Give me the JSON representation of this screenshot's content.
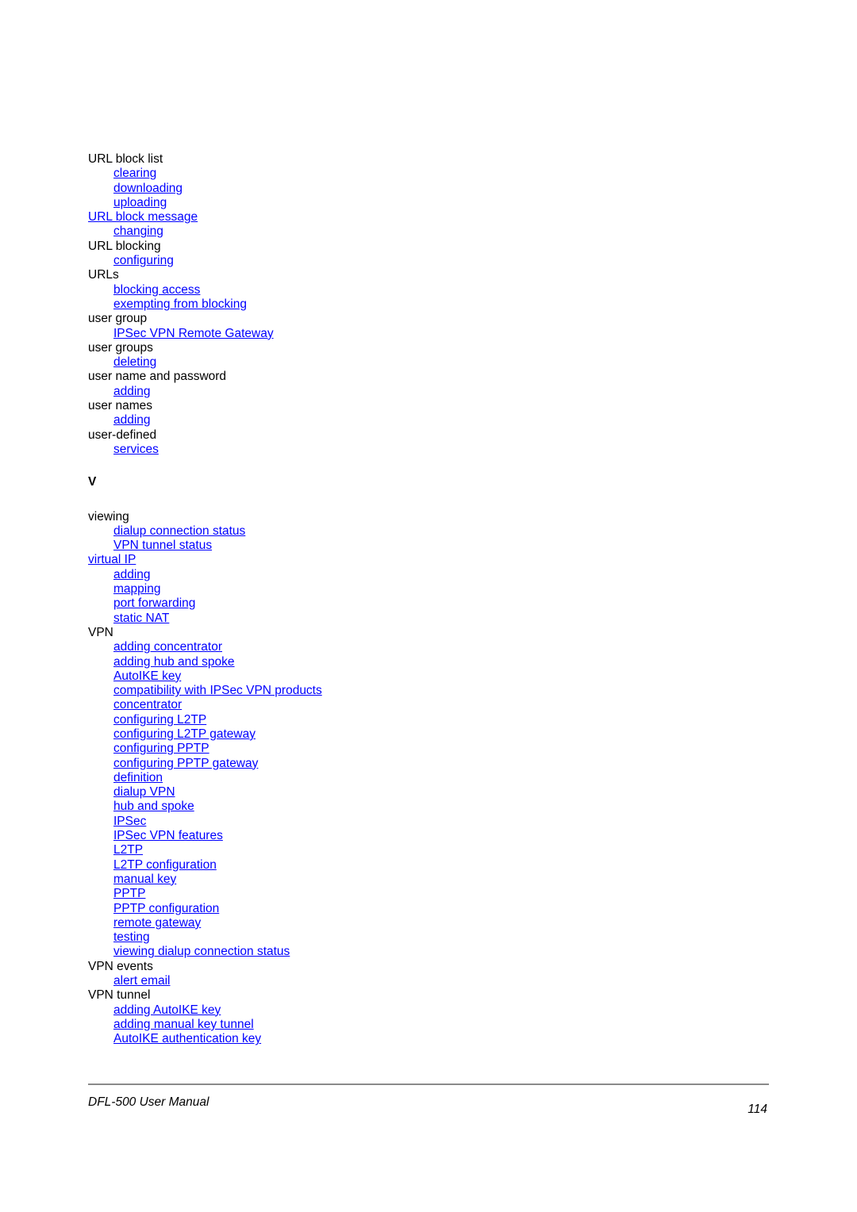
{
  "index": {
    "group_u": [
      {
        "text": "URL block list",
        "level": 0,
        "link": false
      },
      {
        "text": "clearing",
        "level": 1,
        "link": true
      },
      {
        "text": "downloading",
        "level": 1,
        "link": true
      },
      {
        "text": "uploading",
        "level": 1,
        "link": true
      },
      {
        "text": "URL block message",
        "level": 0,
        "link": true
      },
      {
        "text": "changing",
        "level": 1,
        "link": true
      },
      {
        "text": "URL blocking",
        "level": 0,
        "link": false
      },
      {
        "text": "configuring",
        "level": 1,
        "link": true
      },
      {
        "text": "URLs",
        "level": 0,
        "link": false
      },
      {
        "text": "blocking access",
        "level": 1,
        "link": true
      },
      {
        "text": "exempting from blocking",
        "level": 1,
        "link": true
      },
      {
        "text": "user group",
        "level": 0,
        "link": false
      },
      {
        "text": "IPSec VPN Remote Gateway",
        "level": 1,
        "link": true
      },
      {
        "text": "user groups",
        "level": 0,
        "link": false
      },
      {
        "text": "deleting",
        "level": 1,
        "link": true
      },
      {
        "text": "user name and password",
        "level": 0,
        "link": false
      },
      {
        "text": "adding",
        "level": 1,
        "link": true
      },
      {
        "text": "user names",
        "level": 0,
        "link": false
      },
      {
        "text": "adding",
        "level": 1,
        "link": true
      },
      {
        "text": "user-defined",
        "level": 0,
        "link": false
      },
      {
        "text": "services",
        "level": 1,
        "link": true
      }
    ],
    "letter_v": "V",
    "group_v": [
      {
        "text": "viewing",
        "level": 0,
        "link": false
      },
      {
        "text": "dialup connection status",
        "level": 1,
        "link": true
      },
      {
        "text": "VPN tunnel status",
        "level": 1,
        "link": true
      },
      {
        "text": "virtual IP",
        "level": 0,
        "link": true
      },
      {
        "text": "adding",
        "level": 1,
        "link": true
      },
      {
        "text": "mapping",
        "level": 1,
        "link": true
      },
      {
        "text": "port forwarding",
        "level": 1,
        "link": true
      },
      {
        "text": "static NAT",
        "level": 1,
        "link": true
      },
      {
        "text": "VPN",
        "level": 0,
        "link": false
      },
      {
        "text": "adding concentrator",
        "level": 1,
        "link": true
      },
      {
        "text": "adding hub and spoke",
        "level": 1,
        "link": true
      },
      {
        "text": "AutoIKE key",
        "level": 1,
        "link": true
      },
      {
        "text": "compatibility with IPSec VPN products",
        "level": 1,
        "link": true
      },
      {
        "text": "concentrator",
        "level": 1,
        "link": true
      },
      {
        "text": "configuring L2TP",
        "level": 1,
        "link": true
      },
      {
        "text": "configuring L2TP gateway",
        "level": 1,
        "link": true
      },
      {
        "text": "configuring PPTP",
        "level": 1,
        "link": true
      },
      {
        "text": "configuring PPTP gateway",
        "level": 1,
        "link": true
      },
      {
        "text": "definition",
        "level": 1,
        "link": true
      },
      {
        "text": "dialup VPN",
        "level": 1,
        "link": true
      },
      {
        "text": "hub and spoke",
        "level": 1,
        "link": true
      },
      {
        "text": "IPSec",
        "level": 1,
        "link": true
      },
      {
        "text": "IPSec VPN features",
        "level": 1,
        "link": true
      },
      {
        "text": "L2TP",
        "level": 1,
        "link": true
      },
      {
        "text": "L2TP configuration",
        "level": 1,
        "link": true
      },
      {
        "text": "manual key",
        "level": 1,
        "link": true
      },
      {
        "text": "PPTP",
        "level": 1,
        "link": true
      },
      {
        "text": "PPTP configuration",
        "level": 1,
        "link": true
      },
      {
        "text": "remote gateway",
        "level": 1,
        "link": true
      },
      {
        "text": "testing",
        "level": 1,
        "link": true
      },
      {
        "text": "viewing dialup connection status",
        "level": 1,
        "link": true
      },
      {
        "text": "VPN events",
        "level": 0,
        "link": false
      },
      {
        "text": "alert email",
        "level": 1,
        "link": true
      },
      {
        "text": "VPN tunnel",
        "level": 0,
        "link": false
      },
      {
        "text": "adding AutoIKE key",
        "level": 1,
        "link": true
      },
      {
        "text": "adding manual key tunnel",
        "level": 1,
        "link": true
      },
      {
        "text": "AutoIKE authentication key",
        "level": 1,
        "link": true
      }
    ]
  },
  "footer": {
    "title": "DFL-500 User Manual",
    "page_number": "114"
  },
  "colors": {
    "link": "#0000ff",
    "text": "#000000",
    "rule": "#8a8a8a"
  }
}
